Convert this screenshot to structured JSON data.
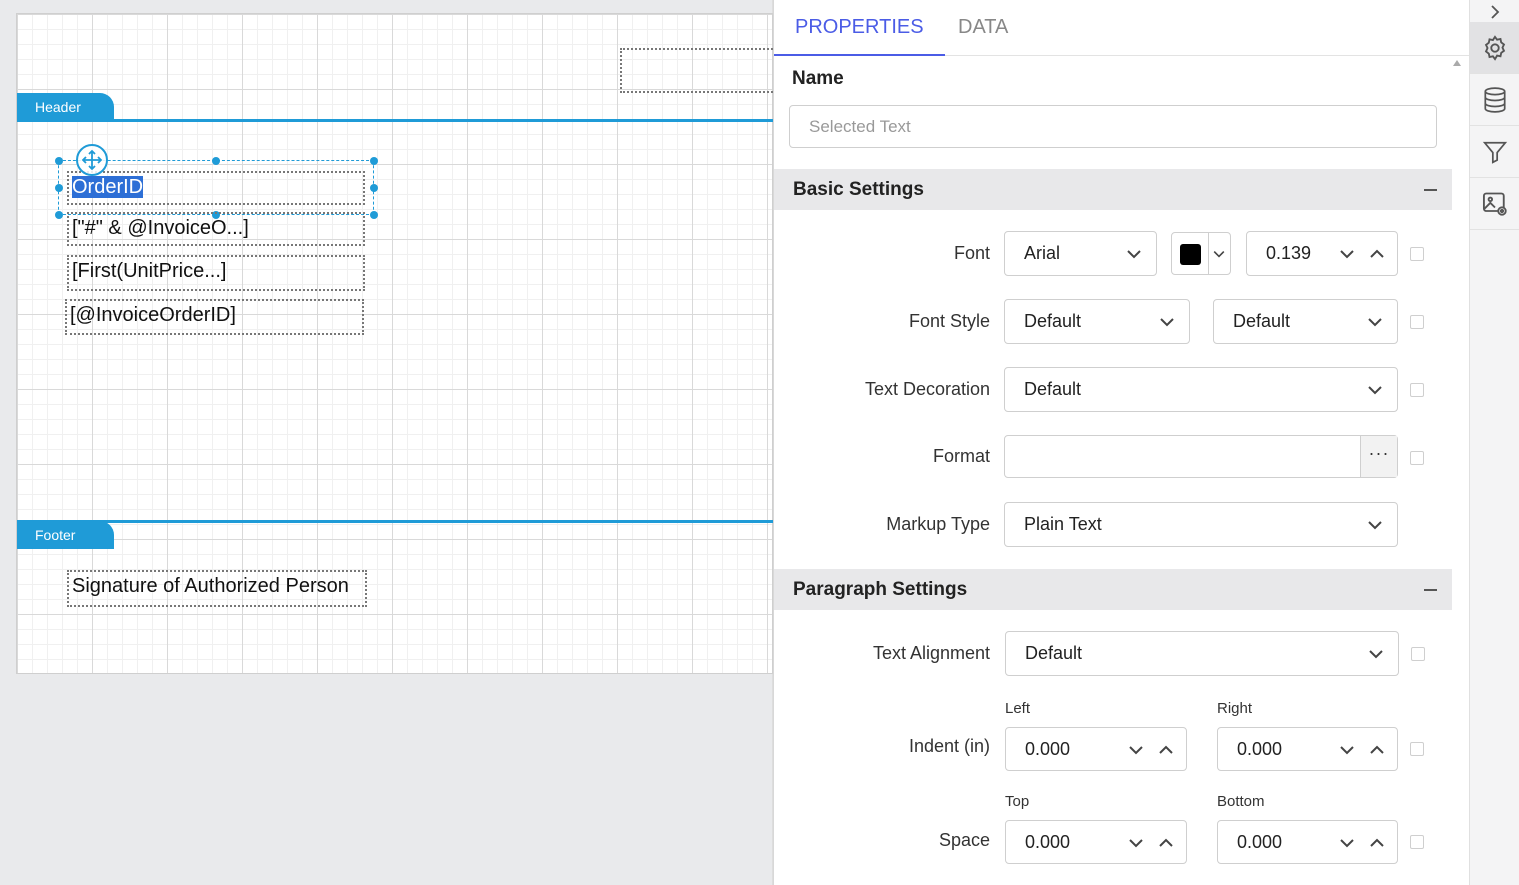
{
  "canvas": {
    "header_band": "Header",
    "footer_band": "Footer",
    "fields": {
      "order_id": "OrderID",
      "invoice_expr": "[\"#\" & @InvoiceO...]",
      "first_unitprice": "[First(UnitPrice...]",
      "invoice_order_id": "[@InvoiceOrderID]",
      "signature": "Signature of Authorized Person"
    }
  },
  "panel": {
    "tabs": [
      "PROPERTIES",
      "DATA"
    ],
    "active_tab": "PROPERTIES",
    "name_label": "Name",
    "name_placeholder": "Selected Text",
    "basic_settings": {
      "title": "Basic Settings",
      "font_label": "Font",
      "font_value": "Arial",
      "font_color": "#000000",
      "font_size": "0.139",
      "font_style_label": "Font Style",
      "font_style_value": "Default",
      "font_weight_value": "Default",
      "text_decoration_label": "Text Decoration",
      "text_decoration_value": "Default",
      "format_label": "Format",
      "format_value": "",
      "format_button": "···",
      "markup_type_label": "Markup Type",
      "markup_type_value": "Plain Text"
    },
    "paragraph_settings": {
      "title": "Paragraph Settings",
      "text_alignment_label": "Text Alignment",
      "text_alignment_value": "Default",
      "indent_label": "Indent (in)",
      "left_label": "Left",
      "right_label": "Right",
      "indent_left": "0.000",
      "indent_right": "0.000",
      "space_label": "Space",
      "top_label": "Top",
      "bottom_label": "Bottom",
      "space_top": "0.000",
      "space_bottom": "0.000"
    }
  },
  "rail": {
    "icons": [
      "chevron-right-icon",
      "gear-icon",
      "database-icon",
      "filter-icon",
      "image-settings-icon"
    ],
    "active": "gear-icon"
  },
  "colors": {
    "accent": "#4b5ce6",
    "band": "#1f9bd7",
    "selection": "#2d6fd6"
  }
}
